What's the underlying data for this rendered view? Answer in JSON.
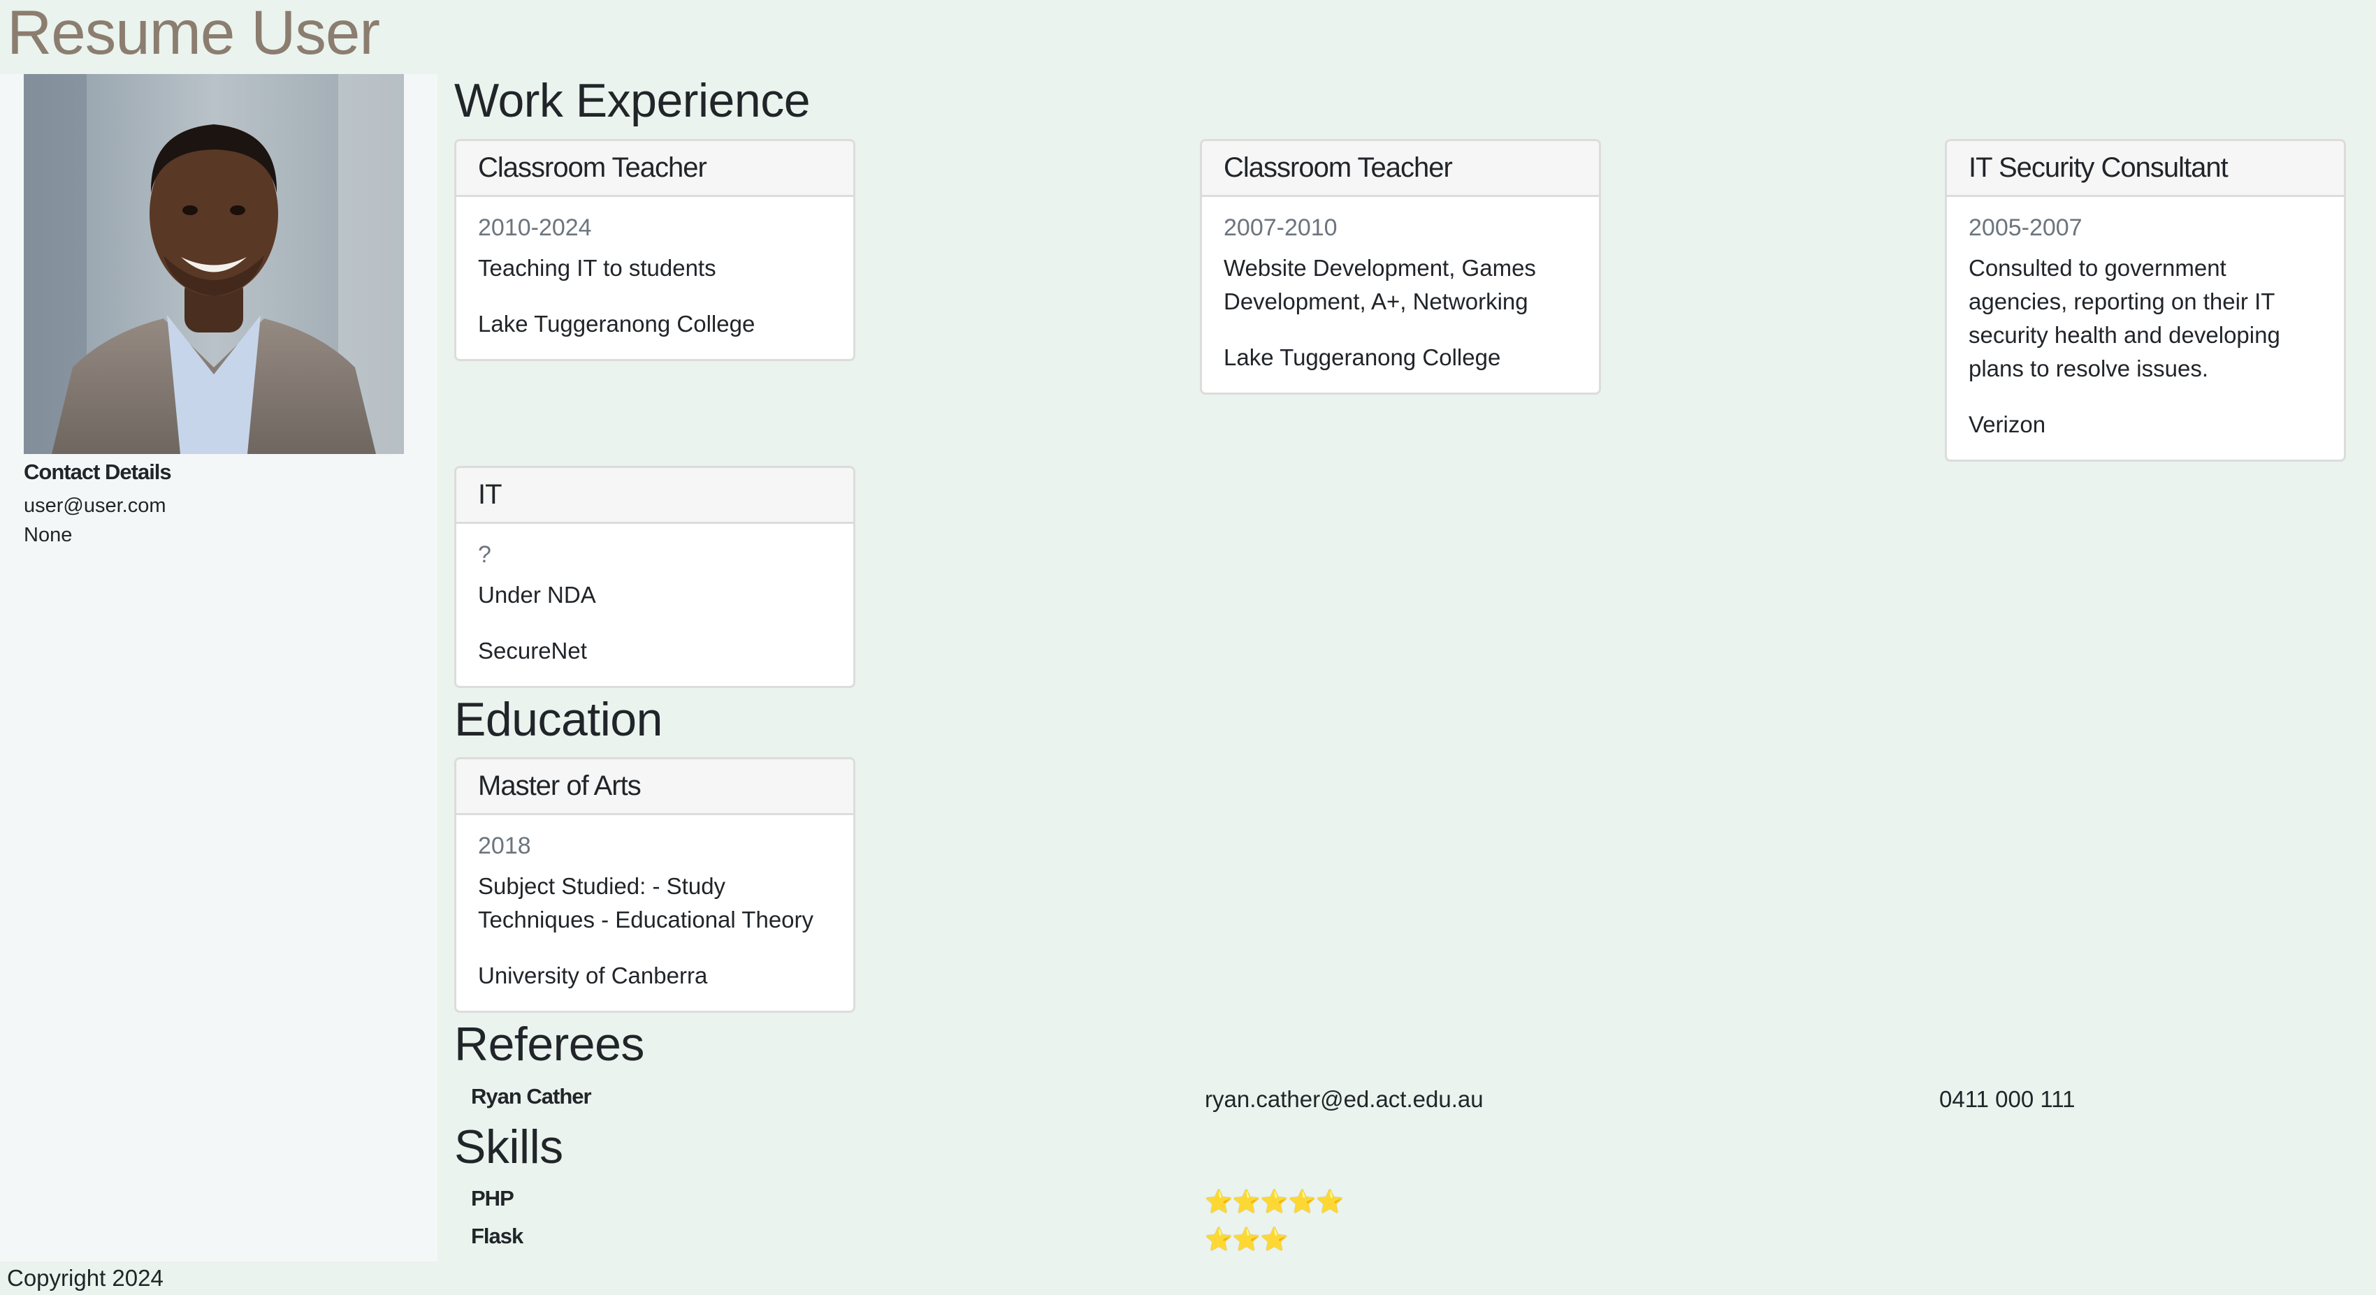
{
  "page": {
    "title": "Resume User"
  },
  "contact": {
    "heading": "Contact Details",
    "email": "user@user.com",
    "phone": "None"
  },
  "work": {
    "heading": "Work Experience",
    "items": [
      {
        "title": "Classroom Teacher",
        "period": "2010-2024",
        "description": "Teaching IT to students",
        "organisation": "Lake Tuggeranong College"
      },
      {
        "title": "Classroom Teacher",
        "period": "2007-2010",
        "description": "Website Development, Games Development, A+, Networking",
        "organisation": "Lake Tuggeranong College"
      },
      {
        "title": "IT Security Consultant",
        "period": "2005-2007",
        "description": "Consulted to government agencies, reporting on their IT security health and developing plans to resolve issues.",
        "organisation": "Verizon"
      },
      {
        "title": "IT",
        "period": "?",
        "description": "Under NDA",
        "organisation": "SecureNet"
      }
    ]
  },
  "education": {
    "heading": "Education",
    "items": [
      {
        "title": "Master of Arts",
        "period": "2018",
        "description": "Subject Studied: - Study Techniques - Educational Theory",
        "organisation": "University of Canberra"
      }
    ]
  },
  "referees": {
    "heading": "Referees",
    "items": [
      {
        "name": "Ryan Cather",
        "email": "ryan.cather@ed.act.edu.au",
        "phone": "0411 000 111"
      }
    ]
  },
  "skills": {
    "heading": "Skills",
    "items": [
      {
        "name": "PHP",
        "stars": "⭐⭐⭐⭐⭐",
        "rating": 5
      },
      {
        "name": "Flask",
        "stars": "⭐⭐⭐",
        "rating": 3
      }
    ]
  },
  "footer": {
    "text": "Copyright 2024"
  }
}
